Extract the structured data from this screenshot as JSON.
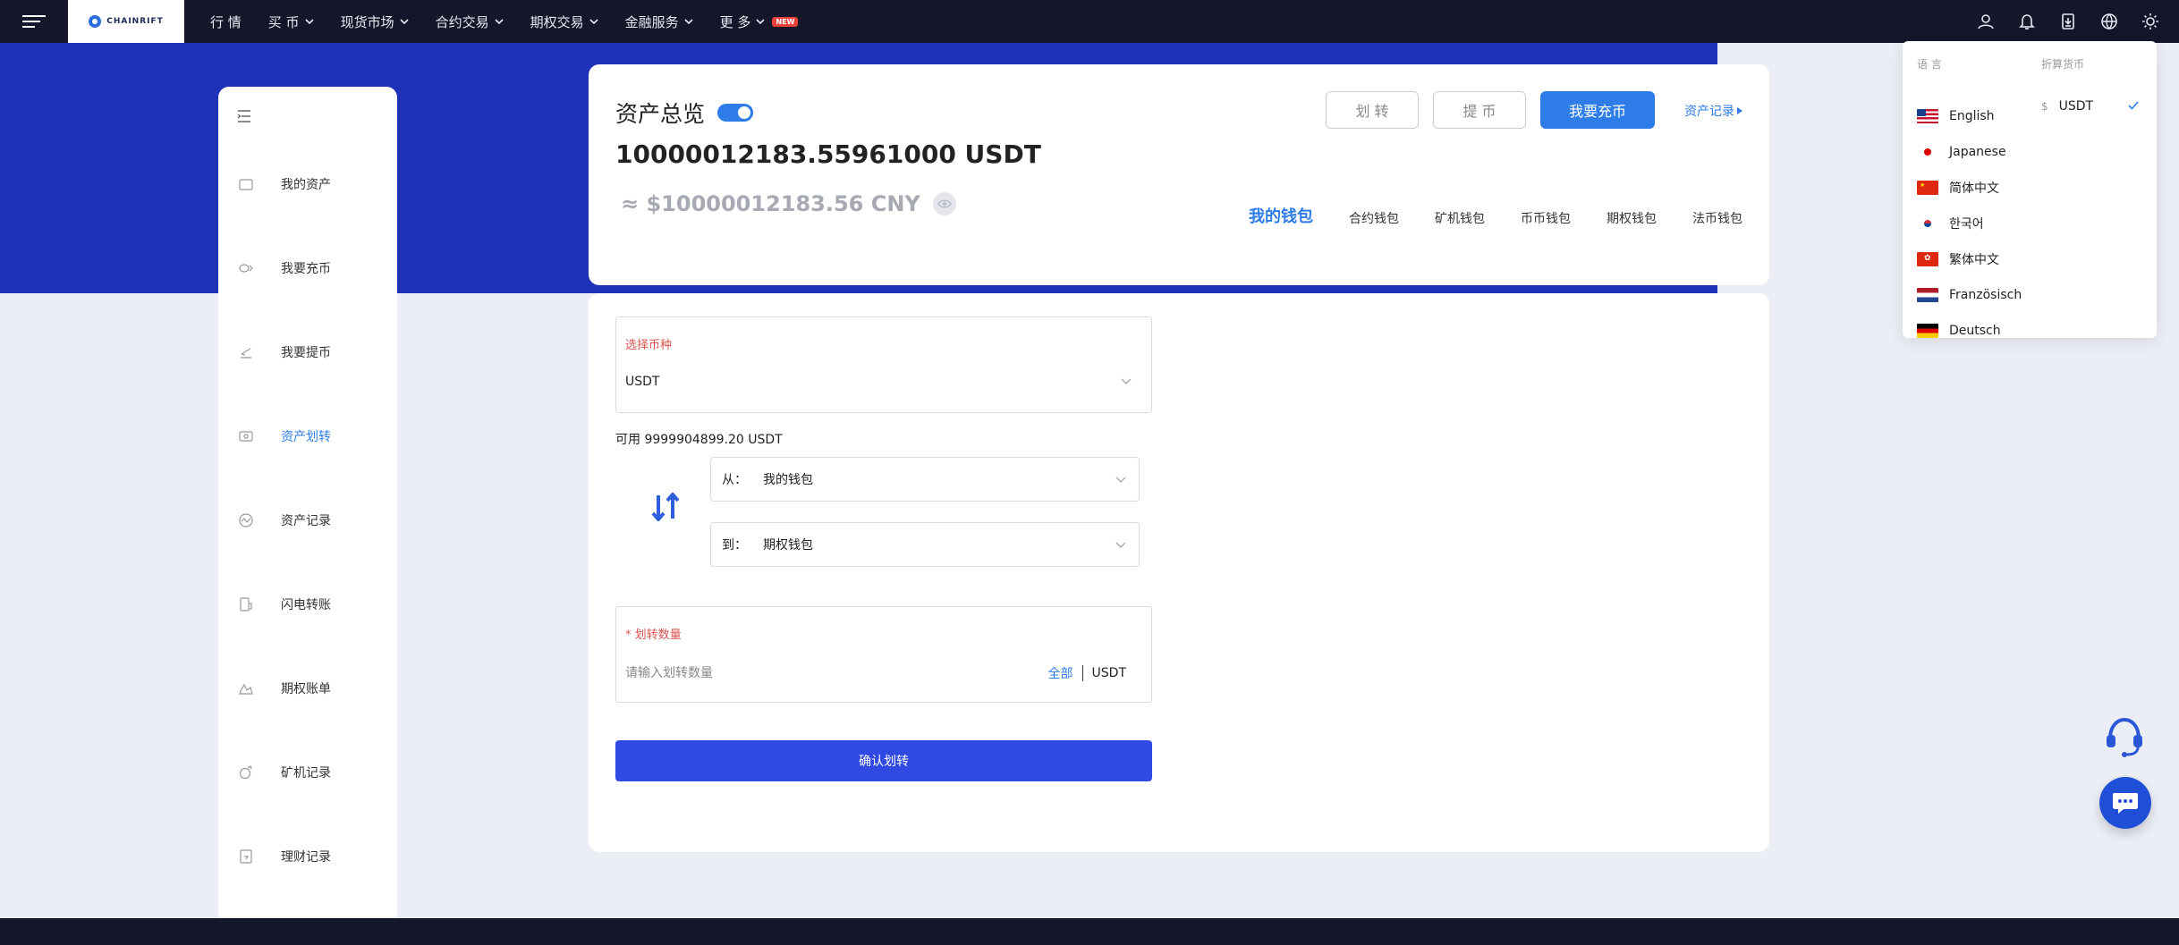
{
  "topnav": {
    "logo_text": "CHAINRIFT",
    "items": [
      {
        "label": "行 情",
        "has_dropdown": false
      },
      {
        "label": "买 币",
        "has_dropdown": true
      },
      {
        "label": "现货市场",
        "has_dropdown": true
      },
      {
        "label": "合约交易",
        "has_dropdown": true
      },
      {
        "label": "期权交易",
        "has_dropdown": true
      },
      {
        "label": "金融服务",
        "has_dropdown": true
      },
      {
        "label": "更 多",
        "has_dropdown": true
      }
    ],
    "new_badge": "NEW",
    "icons": [
      "user-icon",
      "bell-icon",
      "download-icon",
      "globe-icon",
      "sun-icon"
    ]
  },
  "sidebar": {
    "items": [
      {
        "label": "我的资产",
        "icon": "wallet-icon",
        "active": false
      },
      {
        "label": "我要充币",
        "icon": "deposit-icon",
        "active": false
      },
      {
        "label": "我要提币",
        "icon": "withdraw-icon",
        "active": false
      },
      {
        "label": "资产划转",
        "icon": "transfer-icon",
        "active": true
      },
      {
        "label": "资产记录",
        "icon": "records-icon",
        "active": false
      },
      {
        "label": "闪电转账",
        "icon": "flash-icon",
        "active": false
      },
      {
        "label": "期权账单",
        "icon": "bill-icon",
        "active": false
      },
      {
        "label": "矿机记录",
        "icon": "miner-icon",
        "active": false
      },
      {
        "label": "理财记录",
        "icon": "finance-icon",
        "active": false
      }
    ]
  },
  "overview": {
    "title": "资产总览",
    "amount": "10000012183.55961000 USDT",
    "cny": "≈ $10000012183.56 CNY",
    "buttons": {
      "transfer": "划 转",
      "withdraw": "提 币",
      "deposit": "我要充币"
    },
    "records_link": "资产记录",
    "tabs": [
      {
        "label": "我的钱包",
        "active": true
      },
      {
        "label": "合约钱包",
        "active": false
      },
      {
        "label": "矿机钱包",
        "active": false
      },
      {
        "label": "币币钱包",
        "active": false
      },
      {
        "label": "期权钱包",
        "active": false
      },
      {
        "label": "法币钱包",
        "active": false
      }
    ]
  },
  "transfer": {
    "coin_label": "选择币种",
    "coin_value": "USDT",
    "available": "可用 9999904899.20 USDT",
    "from_prefix": "从：",
    "from_value": "我的钱包",
    "to_prefix": "到：",
    "to_value": "期权钱包",
    "amount_label": "* 划转数量",
    "amount_placeholder": "请输入划转数量",
    "all_label": "全部",
    "unit": "USDT",
    "confirm_label": "确认划转"
  },
  "dropdown": {
    "language_header": "语 言",
    "currency_header": "折算货币",
    "languages": [
      {
        "label": "English",
        "flag": "us"
      },
      {
        "label": "Japanese",
        "flag": "jp"
      },
      {
        "label": "简体中文",
        "flag": "cn"
      },
      {
        "label": "한국어",
        "flag": "kr"
      },
      {
        "label": "繁体中文",
        "flag": "hk"
      },
      {
        "label": "Französisch",
        "flag": "nl"
      },
      {
        "label": "Deutsch",
        "flag": "de"
      }
    ],
    "currency": {
      "symbol": "$",
      "label": "USDT",
      "selected": true
    }
  },
  "colors": {
    "nav_bg": "#131729",
    "band_blue": "#1e32b7",
    "accent": "#2e7ce8",
    "confirm": "#3049e2",
    "required_red": "#d9534f"
  }
}
